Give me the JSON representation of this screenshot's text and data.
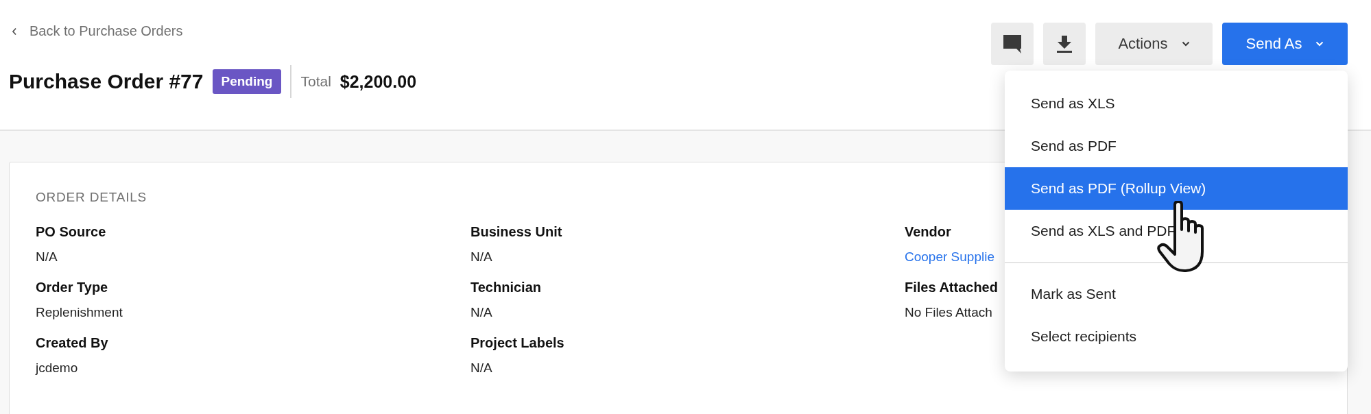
{
  "back_link": {
    "label": "Back to Purchase Orders"
  },
  "order": {
    "title": "Purchase Order #77",
    "status": "Pending",
    "total_label": "Total",
    "total": "$2,200.00"
  },
  "toolbar": {
    "actions_label": "Actions",
    "send_label": "Send As"
  },
  "send_menu": {
    "expanded": true,
    "groups": [
      {
        "items": [
          {
            "label": "Send as XLS",
            "selected": false
          },
          {
            "label": "Send as PDF",
            "selected": false
          },
          {
            "label": "Send as PDF (Rollup View)",
            "selected": true
          },
          {
            "label": "Send as XLS and PDF",
            "selected": false
          }
        ]
      },
      {
        "items": [
          {
            "label": "Mark as Sent",
            "selected": false
          },
          {
            "label": "Select recipients",
            "selected": false
          }
        ]
      }
    ]
  },
  "order_details": {
    "title": "ORDER DETAILS",
    "fields": [
      {
        "label": "PO Source",
        "value": "N/A",
        "kind": "text"
      },
      {
        "label": "Business Unit",
        "value": "N/A",
        "kind": "text"
      },
      {
        "label": "Vendor",
        "value": "Cooper Supplie",
        "kind": "link"
      },
      {
        "label": "Order Type",
        "value": "Replenishment",
        "kind": "text"
      },
      {
        "label": "Technician",
        "value": "N/A",
        "kind": "text"
      },
      {
        "label": "Files Attached",
        "value": "No Files Attach",
        "kind": "text"
      },
      {
        "label": "Created By",
        "value": "jcdemo",
        "kind": "text"
      },
      {
        "label": "Project Labels",
        "value": "N/A",
        "kind": "text"
      }
    ]
  }
}
